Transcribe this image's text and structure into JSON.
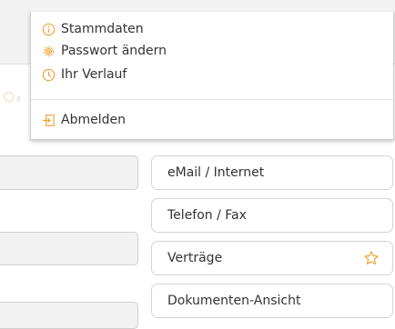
{
  "menu": {
    "items": [
      {
        "label": "Stammdaten",
        "icon": "info-icon"
      },
      {
        "label": "Passwort ändern",
        "icon": "gear-icon"
      },
      {
        "label": "Ihr Verlauf",
        "icon": "clock-icon"
      }
    ],
    "logout": {
      "label": "Abmelden",
      "icon": "logout-icon"
    }
  },
  "nav_buttons": [
    {
      "label": "eMail / Internet"
    },
    {
      "label": "Telefon / Fax"
    },
    {
      "label": "Verträge",
      "icon": "star-icon"
    },
    {
      "label": "Dokumenten-Ansicht"
    }
  ],
  "colors": {
    "accent": "#f0a030",
    "border": "#d3d3d3",
    "field_bg": "#f2f2f2"
  }
}
